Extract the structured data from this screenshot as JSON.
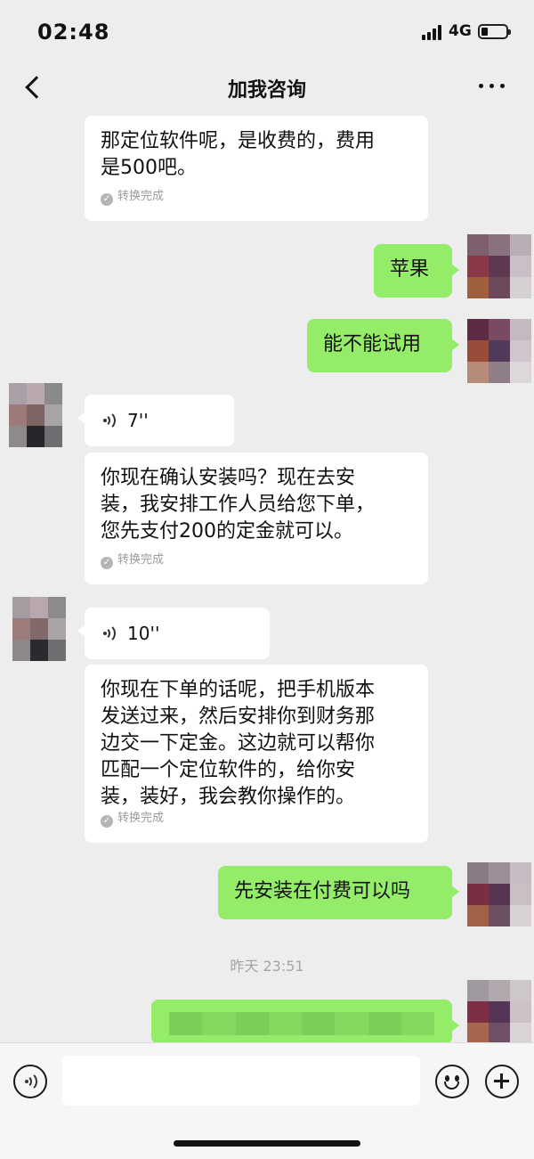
{
  "status_bar": {
    "time": "02:48",
    "network": "4G"
  },
  "nav": {
    "title": "加我咨询",
    "back_icon": "chevron-left-icon",
    "more_icon": "more-dots-icon"
  },
  "messages": {
    "m1": {
      "text": "那定位软件呢，是收费的，费用\n是500吧。",
      "status": "转换完成"
    },
    "m2": {
      "text": "苹果"
    },
    "m3": {
      "text": "能不能试用"
    },
    "m4": {
      "duration": "7''"
    },
    "m5": {
      "text": "你现在确认安装吗？现在去安\n装，我安排工作人员给您下单，\n您先支付200的定金就可以。",
      "status": "转换完成"
    },
    "m6": {
      "duration": "10''"
    },
    "m7": {
      "text": "你现在下单的话呢，把手机版本\n发送过来，然后安排你到财务那\n边交一下定金。这边就可以帮你\n匹配一个定位软件的，给你安\n装，装好，我会教你操作的。",
      "status": "转换完成"
    },
    "m8": {
      "text": "先安装在付费可以吗"
    }
  },
  "time_separator": "昨天 23:51",
  "input_bar": {
    "text_value": ""
  },
  "colors": {
    "background": "#ededed",
    "self_bubble": "#95ec69",
    "other_bubble": "#ffffff"
  }
}
